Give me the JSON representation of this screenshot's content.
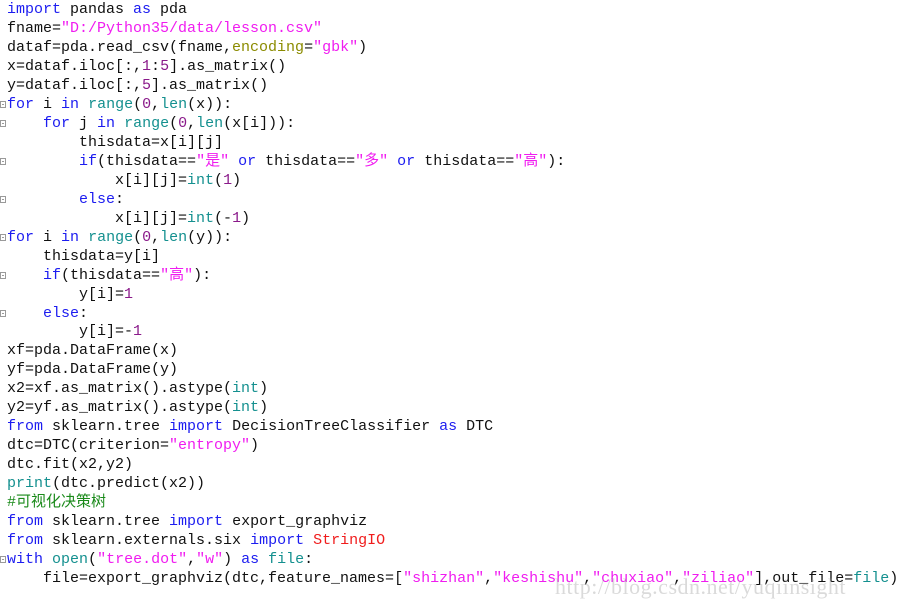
{
  "colors": {
    "keyword": "#1c1cf0",
    "builtin": "#14908f",
    "string": "#f01cf0",
    "number": "#8a1a8a",
    "argument": "#8b8b00",
    "comment": "#1a8a1a",
    "class_name": "#f01c1c",
    "text": "#111111"
  },
  "fold_marker_icon": "collapse-box-icon",
  "fold_lines": [
    6,
    7,
    9,
    11,
    13,
    15,
    17,
    30
  ],
  "code_lines": [
    [
      [
        "k",
        "import"
      ],
      [
        "t",
        " pandas "
      ],
      [
        "k",
        "as"
      ],
      [
        "t",
        " pda"
      ]
    ],
    [
      [
        "t",
        "fname="
      ],
      [
        "s",
        "\"D:/Python35/data/lesson.csv\""
      ]
    ],
    [
      [
        "t",
        "dataf=pda.read_csv(fname,"
      ],
      [
        "a",
        "encoding"
      ],
      [
        "t",
        "="
      ],
      [
        "s",
        "\"gbk\""
      ],
      [
        "t",
        ")"
      ]
    ],
    [
      [
        "t",
        "x=dataf.iloc[:,"
      ],
      [
        "n",
        "1"
      ],
      [
        "t",
        ":"
      ],
      [
        "n",
        "5"
      ],
      [
        "t",
        "].as_matrix()"
      ]
    ],
    [
      [
        "t",
        "y=dataf.iloc[:,"
      ],
      [
        "n",
        "5"
      ],
      [
        "t",
        "].as_matrix()"
      ]
    ],
    [
      [
        "k",
        "for"
      ],
      [
        "t",
        " i "
      ],
      [
        "k",
        "in"
      ],
      [
        "t",
        " "
      ],
      [
        "b",
        "range"
      ],
      [
        "t",
        "("
      ],
      [
        "n",
        "0"
      ],
      [
        "t",
        ","
      ],
      [
        "b",
        "len"
      ],
      [
        "t",
        "(x)):"
      ]
    ],
    [
      [
        "t",
        "    "
      ],
      [
        "k",
        "for"
      ],
      [
        "t",
        " j "
      ],
      [
        "k",
        "in"
      ],
      [
        "t",
        " "
      ],
      [
        "b",
        "range"
      ],
      [
        "t",
        "("
      ],
      [
        "n",
        "0"
      ],
      [
        "t",
        ","
      ],
      [
        "b",
        "len"
      ],
      [
        "t",
        "(x[i])):"
      ]
    ],
    [
      [
        "t",
        "        thisdata=x[i][j]"
      ]
    ],
    [
      [
        "t",
        "        "
      ],
      [
        "k",
        "if"
      ],
      [
        "t",
        "(thisdata=="
      ],
      [
        "s",
        "\"是\""
      ],
      [
        "t",
        " "
      ],
      [
        "k",
        "or"
      ],
      [
        "t",
        " thisdata=="
      ],
      [
        "s",
        "\"多\""
      ],
      [
        "t",
        " "
      ],
      [
        "k",
        "or"
      ],
      [
        "t",
        " thisdata=="
      ],
      [
        "s",
        "\"高\""
      ],
      [
        "t",
        "):"
      ]
    ],
    [
      [
        "t",
        "            x[i][j]="
      ],
      [
        "b",
        "int"
      ],
      [
        "t",
        "("
      ],
      [
        "n",
        "1"
      ],
      [
        "t",
        ")"
      ]
    ],
    [
      [
        "t",
        "        "
      ],
      [
        "k",
        "else"
      ],
      [
        "t",
        ":"
      ]
    ],
    [
      [
        "t",
        "            x[i][j]="
      ],
      [
        "b",
        "int"
      ],
      [
        "t",
        "(-"
      ],
      [
        "n",
        "1"
      ],
      [
        "t",
        ")"
      ]
    ],
    [
      [
        "k",
        "for"
      ],
      [
        "t",
        " i "
      ],
      [
        "k",
        "in"
      ],
      [
        "t",
        " "
      ],
      [
        "b",
        "range"
      ],
      [
        "t",
        "("
      ],
      [
        "n",
        "0"
      ],
      [
        "t",
        ","
      ],
      [
        "b",
        "len"
      ],
      [
        "t",
        "(y)):"
      ]
    ],
    [
      [
        "t",
        "    thisdata=y[i]"
      ]
    ],
    [
      [
        "t",
        "    "
      ],
      [
        "k",
        "if"
      ],
      [
        "t",
        "(thisdata=="
      ],
      [
        "s",
        "\"高\""
      ],
      [
        "t",
        "):"
      ]
    ],
    [
      [
        "t",
        "        y[i]="
      ],
      [
        "n",
        "1"
      ]
    ],
    [
      [
        "t",
        "    "
      ],
      [
        "k",
        "else"
      ],
      [
        "t",
        ":"
      ]
    ],
    [
      [
        "t",
        "        y[i]=-"
      ],
      [
        "n",
        "1"
      ]
    ],
    [
      [
        "t",
        "xf=pda.DataFrame(x)"
      ]
    ],
    [
      [
        "t",
        "yf=pda.DataFrame(y)"
      ]
    ],
    [
      [
        "t",
        "x2=xf.as_matrix().astype("
      ],
      [
        "b",
        "int"
      ],
      [
        "t",
        ")"
      ]
    ],
    [
      [
        "t",
        "y2=yf.as_matrix().astype("
      ],
      [
        "b",
        "int"
      ],
      [
        "t",
        ")"
      ]
    ],
    [
      [
        "k",
        "from"
      ],
      [
        "t",
        " sklearn.tree "
      ],
      [
        "k",
        "import"
      ],
      [
        "t",
        " DecisionTreeClassifier "
      ],
      [
        "k",
        "as"
      ],
      [
        "t",
        " DTC"
      ]
    ],
    [
      [
        "t",
        "dtc=DTC(criterion="
      ],
      [
        "s",
        "\"entropy\""
      ],
      [
        "t",
        ")"
      ]
    ],
    [
      [
        "t",
        "dtc.fit(x2,y2)"
      ]
    ],
    [
      [
        "b",
        "print"
      ],
      [
        "t",
        "(dtc.predict(x2))"
      ]
    ],
    [
      [
        "c",
        "#可视化决策树"
      ]
    ],
    [
      [
        "k",
        "from"
      ],
      [
        "t",
        " sklearn.tree "
      ],
      [
        "k",
        "import"
      ],
      [
        "t",
        " export_graphviz"
      ]
    ],
    [
      [
        "k",
        "from"
      ],
      [
        "t",
        " sklearn.externals.six "
      ],
      [
        "k",
        "import"
      ],
      [
        "t",
        " "
      ],
      [
        "r",
        "StringIO"
      ]
    ],
    [
      [
        "k",
        "with"
      ],
      [
        "t",
        " "
      ],
      [
        "b",
        "open"
      ],
      [
        "t",
        "("
      ],
      [
        "s",
        "\"tree.dot\""
      ],
      [
        "t",
        ","
      ],
      [
        "s",
        "\"w\""
      ],
      [
        "t",
        ") "
      ],
      [
        "k",
        "as"
      ],
      [
        "t",
        " "
      ],
      [
        "b",
        "file"
      ],
      [
        "t",
        ":"
      ]
    ],
    [
      [
        "t",
        "    file=export_graphviz(dtc,feature_names=["
      ],
      [
        "s",
        "\"shizhan\""
      ],
      [
        "t",
        ","
      ],
      [
        "s",
        "\"keshishu\""
      ],
      [
        "t",
        ","
      ],
      [
        "s",
        "\"chuxiao\""
      ],
      [
        "t",
        ","
      ],
      [
        "s",
        "\"ziliao\""
      ],
      [
        "t",
        "],out_file="
      ],
      [
        "b",
        "file"
      ],
      [
        "t",
        ")"
      ]
    ]
  ],
  "watermark": "http://blog.csdn.net/yuqiinsight"
}
